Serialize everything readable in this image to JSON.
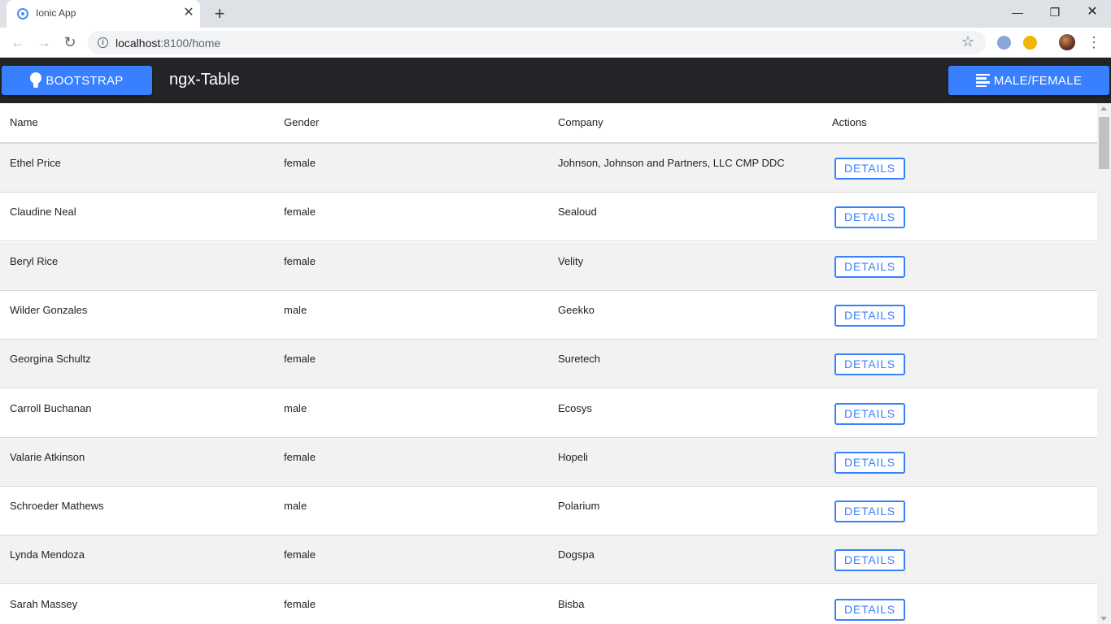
{
  "browser": {
    "tab_title": "Ionic App",
    "url_host": "localhost",
    "url_path": ":8100/home",
    "icons": {
      "favicon": "ionic-favicon-icon",
      "close": "close-icon",
      "new_tab": "plus-icon",
      "back": "back-arrow-icon",
      "forward": "forward-arrow-icon",
      "reload": "reload-icon",
      "info": "info-icon",
      "bookmark": "star-icon",
      "menu": "kebab-menu-icon"
    },
    "glyphs": {
      "close": "✕",
      "new_tab": "+",
      "back": "←",
      "forward": "→",
      "reload": "↻",
      "info": "i",
      "star": "☆",
      "menu": "⋮",
      "minimize": "—",
      "maximize": "❐",
      "window_close": "✕"
    }
  },
  "header": {
    "bootstrap_label": "BOOTSTRAP",
    "title": "ngx-Table",
    "gender_label": "MALE/FEMALE",
    "accent_color": "#3880ff",
    "bar_color": "#222428"
  },
  "table": {
    "columns": [
      "Name",
      "Gender",
      "Company",
      "Actions"
    ],
    "action_label": "DETAILS",
    "rows": [
      {
        "name": "Ethel Price",
        "gender": "female",
        "company": "Johnson, Johnson and Partners, LLC CMP DDC"
      },
      {
        "name": "Claudine Neal",
        "gender": "female",
        "company": "Sealoud"
      },
      {
        "name": "Beryl Rice",
        "gender": "female",
        "company": "Velity"
      },
      {
        "name": "Wilder Gonzales",
        "gender": "male",
        "company": "Geekko"
      },
      {
        "name": "Georgina Schultz",
        "gender": "female",
        "company": "Suretech"
      },
      {
        "name": "Carroll Buchanan",
        "gender": "male",
        "company": "Ecosys"
      },
      {
        "name": "Valarie Atkinson",
        "gender": "female",
        "company": "Hopeli"
      },
      {
        "name": "Schroeder Mathews",
        "gender": "male",
        "company": "Polarium"
      },
      {
        "name": "Lynda Mendoza",
        "gender": "female",
        "company": "Dogspa"
      },
      {
        "name": "Sarah Massey",
        "gender": "female",
        "company": "Bisba"
      }
    ]
  }
}
